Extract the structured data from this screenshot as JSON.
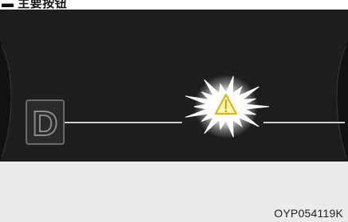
{
  "header": {
    "title": "▬ 主要按钮"
  },
  "display": {
    "gear_indicator": "D",
    "warning_icon": "warning-triangle-icon",
    "background_color": "#1e1e1e",
    "line_color": "#cfcfcf",
    "gear_box_color": "#3c3c3c"
  },
  "caption": {
    "figure_id": "OYP054119K"
  }
}
